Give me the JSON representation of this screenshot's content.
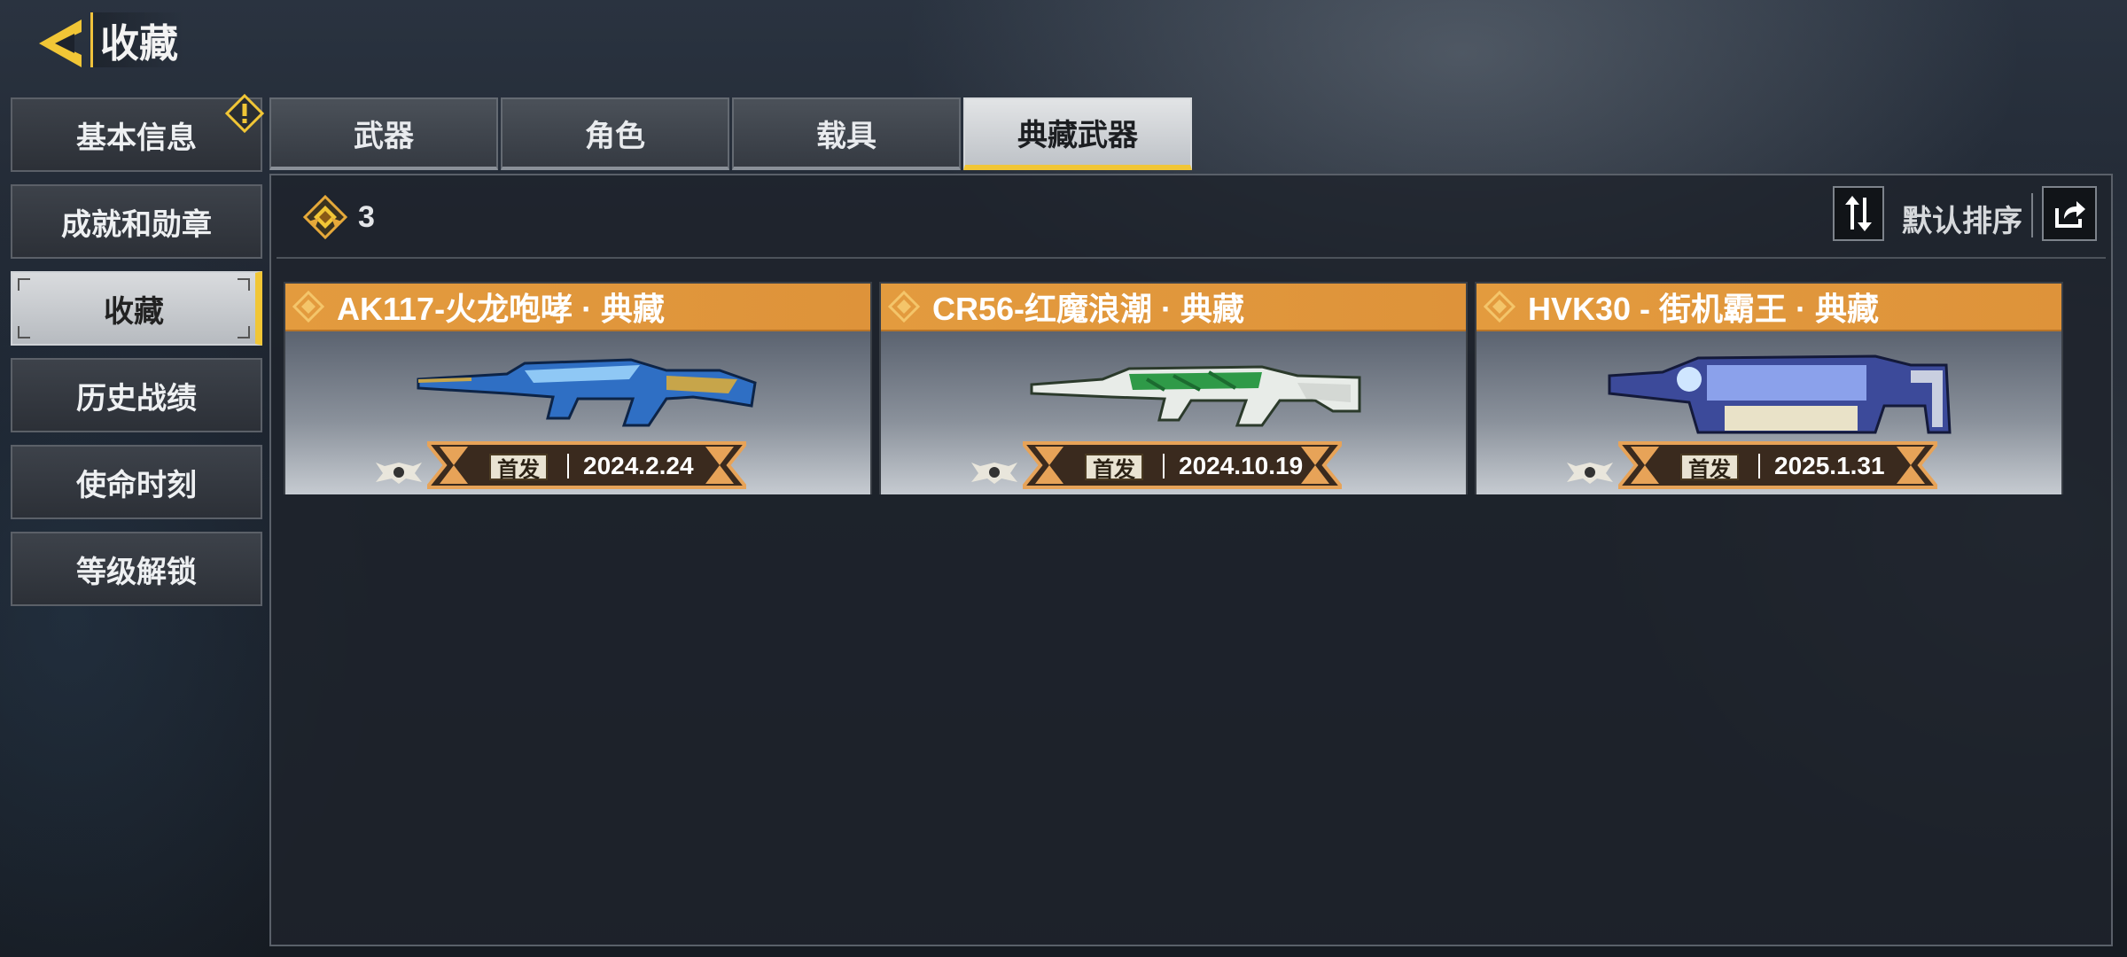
{
  "header": {
    "title": "收藏"
  },
  "sidebar": {
    "items": [
      {
        "label": "基本信息",
        "active": false,
        "warning": true
      },
      {
        "label": "成就和勋章",
        "active": false
      },
      {
        "label": "收藏",
        "active": true
      },
      {
        "label": "历史战绩",
        "active": false
      },
      {
        "label": "使命时刻",
        "active": false
      },
      {
        "label": "等级解锁",
        "active": false
      }
    ]
  },
  "tabs": [
    {
      "label": "武器",
      "active": false
    },
    {
      "label": "角色",
      "active": false
    },
    {
      "label": "载具",
      "active": false
    },
    {
      "label": "典藏武器",
      "active": true
    }
  ],
  "toolbar": {
    "count": "3",
    "sort_label": "默认排序",
    "icons": {
      "count": "diamond-rank-icon",
      "sort": "sort-toggle-icon",
      "share": "share-icon"
    }
  },
  "cards": [
    {
      "name": "AK117-火龙咆哮 · 典藏",
      "first_label": "首发",
      "date": "2024.2.24",
      "skin_color": "#3a7fd0"
    },
    {
      "name": "CR56-红魔浪潮 · 典藏",
      "first_label": "首发",
      "date": "2024.10.19",
      "skin_color": "#2f9a48"
    },
    {
      "name": "HVK30 - 街机霸王 · 典藏",
      "first_label": "首发",
      "date": "2025.1.31",
      "skin_color": "#5a6ad8"
    }
  ],
  "colors": {
    "accent": "#f1c636",
    "card_header": "#e39b3e"
  }
}
